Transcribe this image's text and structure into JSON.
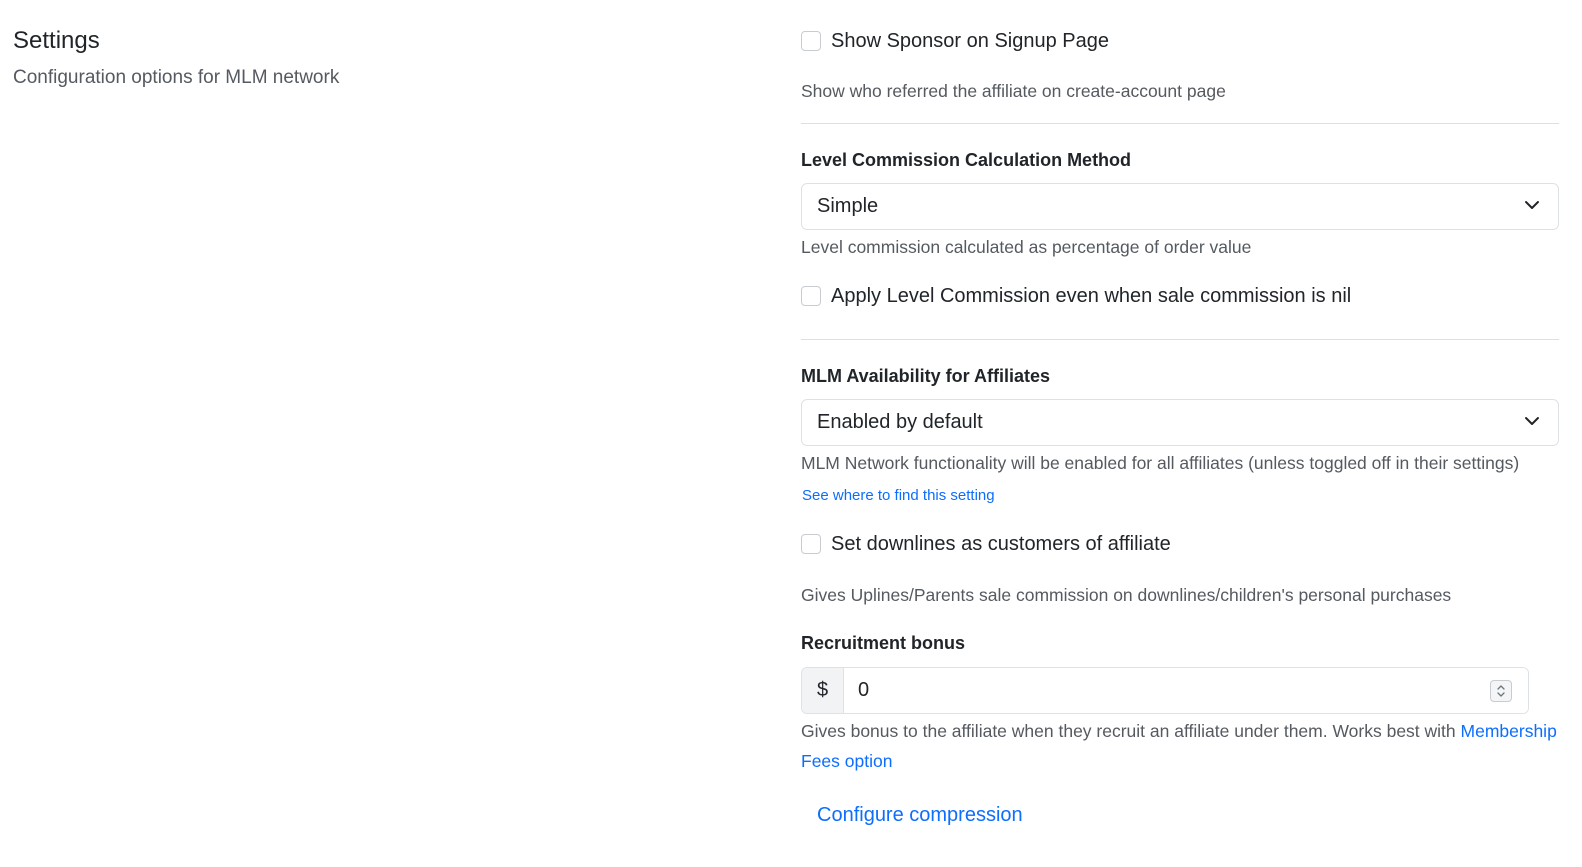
{
  "left": {
    "title": "Settings",
    "description": "Configuration options for MLM network"
  },
  "sponsor": {
    "checked": false,
    "label": "Show Sponsor on Signup Page",
    "help": "Show who referred the affiliate on create-account page"
  },
  "level_commission": {
    "label": "Level Commission Calculation Method",
    "selected": "Simple",
    "help": "Level commission calculated as percentage of order value"
  },
  "apply_level": {
    "checked": false,
    "label": "Apply Level Commission even when sale commission is nil"
  },
  "mlm_availability": {
    "label": "MLM Availability for Affiliates",
    "selected": "Enabled by default",
    "help": "MLM Network functionality will be enabled for all affiliates (unless toggled off in their settings)",
    "link": "See where to find this setting"
  },
  "downlines": {
    "checked": false,
    "label": "Set downlines as customers of affiliate",
    "help": "Gives Uplines/Parents sale commission on downlines/children's personal purchases"
  },
  "recruitment": {
    "label": "Recruitment bonus",
    "currency": "$",
    "value": "0",
    "help_text": "Gives bonus to the affiliate when they recruit an affiliate under them. Works best with ",
    "help_link": "Membership Fees option"
  },
  "configure_link": "Configure compression",
  "icons": {
    "chevron": "chevron-down-icon",
    "spinner": "spinner-arrows-icon"
  },
  "colors": {
    "link": "#0d6efd",
    "muted_text": "#555a60",
    "border": "#dee2e6"
  }
}
